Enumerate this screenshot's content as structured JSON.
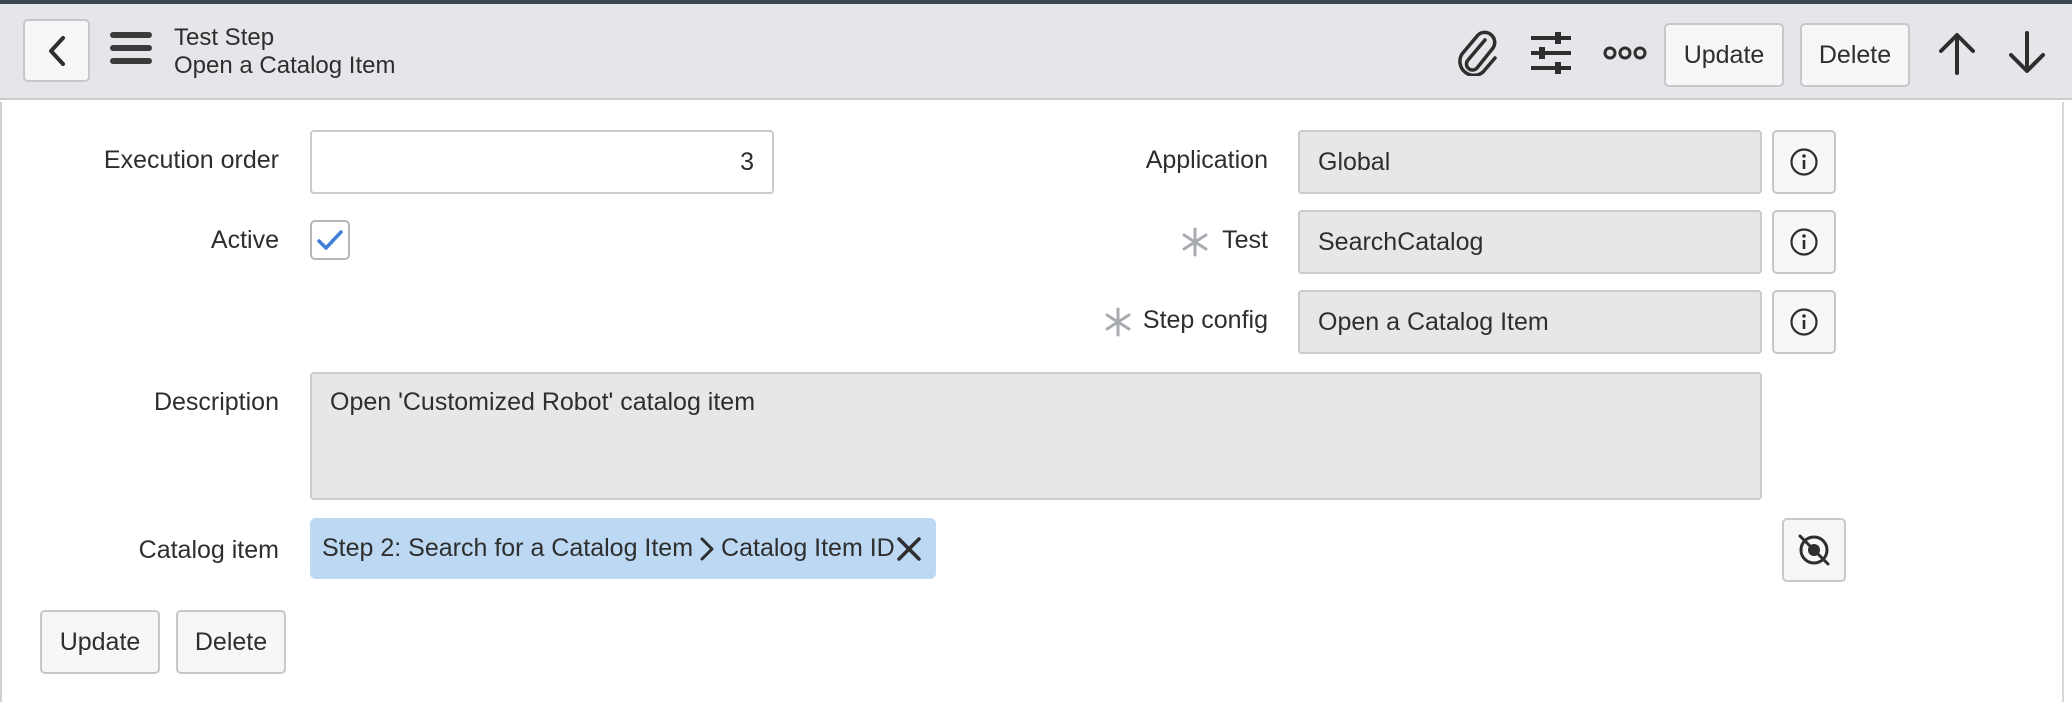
{
  "header": {
    "title_line1": "Test Step",
    "title_line2": "Open a Catalog Item",
    "update_label": "Update",
    "delete_label": "Delete",
    "icons": [
      "back-icon",
      "hamburger-icon",
      "paperclip-icon",
      "sliders-icon",
      "more-icon",
      "arrow-up-icon",
      "arrow-down-icon"
    ]
  },
  "form": {
    "execution_order_label": "Execution order",
    "execution_order_value": "3",
    "active_label": "Active",
    "active_checked": true,
    "application_label": "Application",
    "application_value": "Global",
    "test_label": "Test",
    "test_value": "SearchCatalog",
    "step_config_label": "Step config",
    "step_config_value": "Open a Catalog Item",
    "description_label": "Description",
    "description_value": "Open 'Customized Robot' catalog item",
    "catalog_item_label": "Catalog item",
    "catalog_item_part1": "Step 2: Search for a Catalog Item",
    "catalog_item_part2": "Catalog Item ID"
  },
  "footer": {
    "update_label": "Update",
    "delete_label": "Delete"
  },
  "colors": {
    "header_bg": "#e5e6e9",
    "readonly_bg": "#e6e7e9",
    "pill_bg": "#bcd8f2",
    "check_blue": "#3f7fd6",
    "required_gray": "#a8abb0"
  }
}
